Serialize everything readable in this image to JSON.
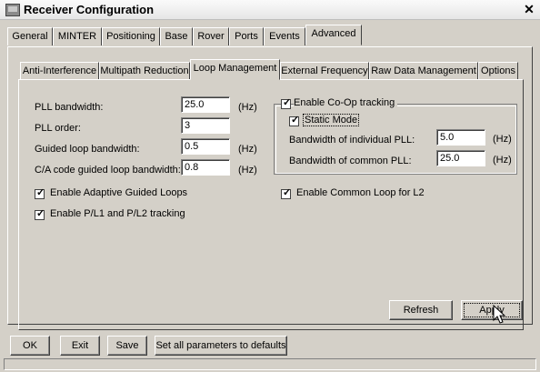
{
  "window": {
    "title": "Receiver Configuration",
    "close_symbol": "✕"
  },
  "top_tabs": [
    "General",
    "MINTER",
    "Positioning",
    "Base",
    "Rover",
    "Ports",
    "Events",
    "Advanced"
  ],
  "inner_tabs": [
    "Anti-Interference",
    "Multipath Reduction",
    "Loop Management",
    "External Frequency",
    "Raw Data Management",
    "Options"
  ],
  "loop": {
    "pll_bandwidth": {
      "label": "PLL bandwidth:",
      "value": "25.0",
      "unit": "(Hz)"
    },
    "pll_order": {
      "label": "PLL order:",
      "value": "3"
    },
    "guided_bw": {
      "label": "Guided loop bandwidth:",
      "value": "0.5",
      "unit": "(Hz)"
    },
    "ca_guided_bw": {
      "label": "C/A code guided loop bandwidth:",
      "value": "0.8",
      "unit": "(Hz)"
    },
    "adaptive": {
      "label": "Enable Adaptive Guided Loops",
      "checked": true
    },
    "pl_tracking": {
      "label": "Enable P/L1 and P/L2 tracking",
      "checked": true
    },
    "coop": {
      "label": "Enable Co-Op tracking",
      "checked": true
    },
    "static_mode": {
      "label": "Static Mode",
      "checked": true
    },
    "individual_pll": {
      "label": "Bandwidth of individual PLL:",
      "value": "5.0",
      "unit": "(Hz)"
    },
    "common_pll": {
      "label": "Bandwidth of common PLL:",
      "value": "25.0",
      "unit": "(Hz)"
    },
    "common_l2": {
      "label": "Enable Common Loop for L2",
      "checked": true
    },
    "refresh_label": "Refresh",
    "apply_label": "Apply"
  },
  "bottom": {
    "ok_label": "OK",
    "exit_label": "Exit",
    "save_label": "Save",
    "defaults_label": "Set all parameters to defaults"
  },
  "icons": {
    "check": "✓",
    "window_icon": "window-icon",
    "cursor": "mouse-pointer-icon"
  }
}
